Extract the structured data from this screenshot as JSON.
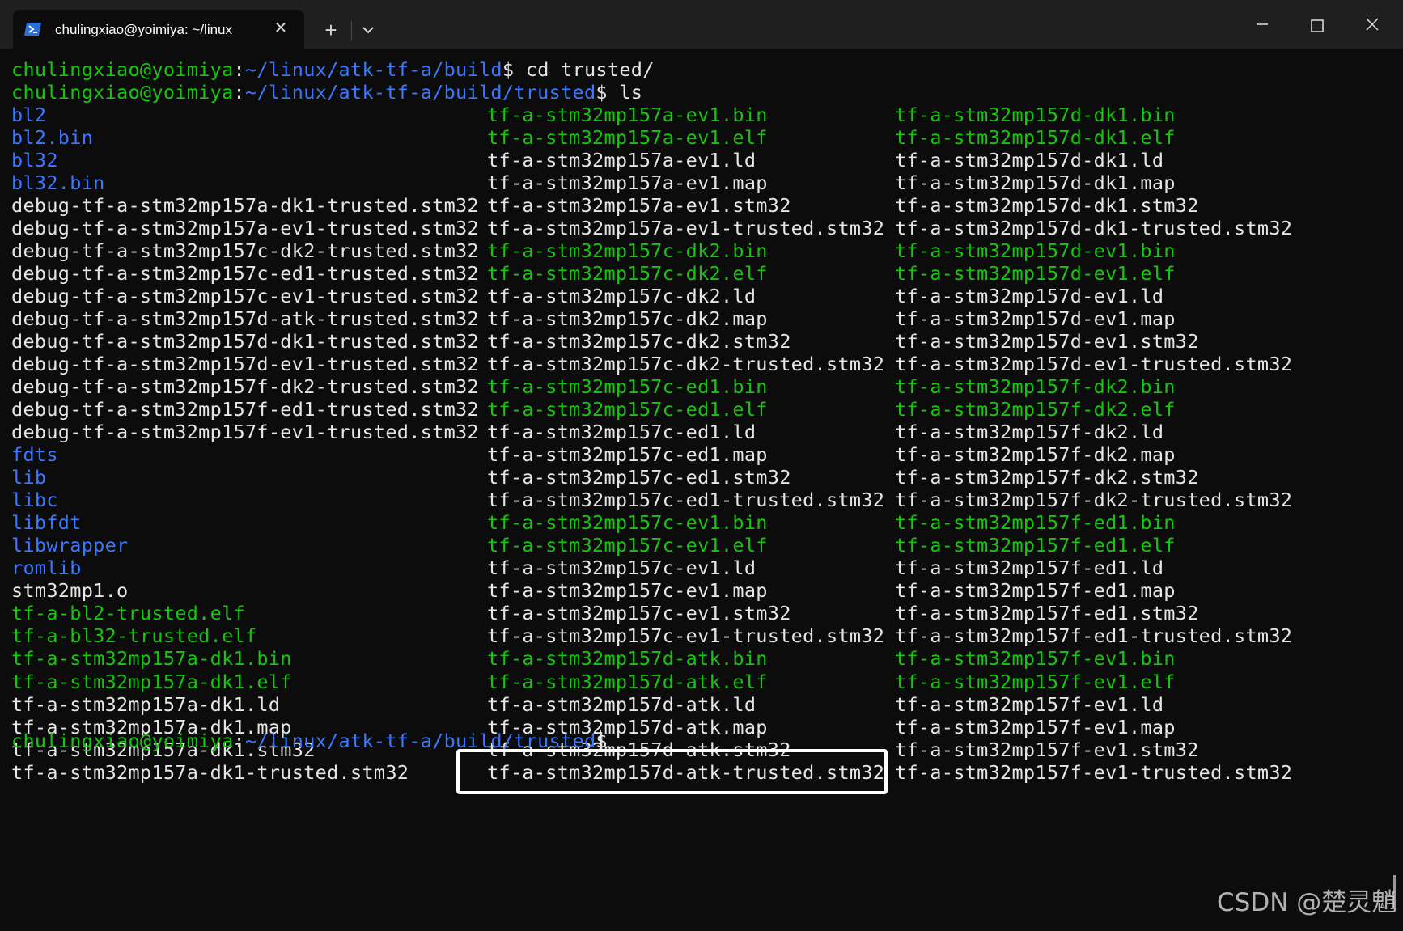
{
  "window": {
    "tab_title": "chulingxiao@yoimiya: ~/linux",
    "new_tab_symbol": "+",
    "close_tab_symbol": "✕"
  },
  "colors": {
    "background": "#0c0c0c",
    "prompt_user": "#16c60c",
    "prompt_path": "#3b78ff",
    "text": "#e6e6e6",
    "executable": "#16c60c",
    "directory": "#3b78ff"
  },
  "prompts": [
    {
      "user": "chulingxiao@yoimiya",
      "path": "~/linux/atk-tf-a/build",
      "command": " cd trusted/"
    },
    {
      "user": "chulingxiao@yoimiya",
      "path": "~/linux/atk-tf-a/build/trusted",
      "command": " ls"
    }
  ],
  "listing": [
    [
      {
        "name": "bl2",
        "kind": "dir"
      },
      {
        "name": "bl2.bin",
        "kind": "dir"
      },
      {
        "name": "bl32",
        "kind": "dir"
      },
      {
        "name": "bl32.bin",
        "kind": "dir"
      },
      {
        "name": "debug-tf-a-stm32mp157a-dk1-trusted.stm32",
        "kind": "file"
      },
      {
        "name": "debug-tf-a-stm32mp157a-ev1-trusted.stm32",
        "kind": "file"
      },
      {
        "name": "debug-tf-a-stm32mp157c-dk2-trusted.stm32",
        "kind": "file"
      },
      {
        "name": "debug-tf-a-stm32mp157c-ed1-trusted.stm32",
        "kind": "file"
      },
      {
        "name": "debug-tf-a-stm32mp157c-ev1-trusted.stm32",
        "kind": "file"
      },
      {
        "name": "debug-tf-a-stm32mp157d-atk-trusted.stm32",
        "kind": "file"
      },
      {
        "name": "debug-tf-a-stm32mp157d-dk1-trusted.stm32",
        "kind": "file"
      },
      {
        "name": "debug-tf-a-stm32mp157d-ev1-trusted.stm32",
        "kind": "file"
      },
      {
        "name": "debug-tf-a-stm32mp157f-dk2-trusted.stm32",
        "kind": "file"
      },
      {
        "name": "debug-tf-a-stm32mp157f-ed1-trusted.stm32",
        "kind": "file"
      },
      {
        "name": "debug-tf-a-stm32mp157f-ev1-trusted.stm32",
        "kind": "file"
      },
      {
        "name": "fdts",
        "kind": "dir"
      },
      {
        "name": "lib",
        "kind": "dir"
      },
      {
        "name": "libc",
        "kind": "dir"
      },
      {
        "name": "libfdt",
        "kind": "dir"
      },
      {
        "name": "libwrapper",
        "kind": "dir"
      },
      {
        "name": "romlib",
        "kind": "dir"
      },
      {
        "name": "stm32mp1.o",
        "kind": "file"
      },
      {
        "name": "tf-a-bl2-trusted.elf",
        "kind": "exec"
      },
      {
        "name": "tf-a-bl32-trusted.elf",
        "kind": "exec"
      },
      {
        "name": "tf-a-stm32mp157a-dk1.bin",
        "kind": "exec"
      },
      {
        "name": "tf-a-stm32mp157a-dk1.elf",
        "kind": "exec"
      },
      {
        "name": "tf-a-stm32mp157a-dk1.ld",
        "kind": "file"
      },
      {
        "name": "tf-a-stm32mp157a-dk1.map",
        "kind": "file"
      },
      {
        "name": "tf-a-stm32mp157a-dk1.stm32",
        "kind": "file"
      },
      {
        "name": "tf-a-stm32mp157a-dk1-trusted.stm32",
        "kind": "file"
      }
    ],
    [
      {
        "name": "tf-a-stm32mp157a-ev1.bin",
        "kind": "exec"
      },
      {
        "name": "tf-a-stm32mp157a-ev1.elf",
        "kind": "exec"
      },
      {
        "name": "tf-a-stm32mp157a-ev1.ld",
        "kind": "file"
      },
      {
        "name": "tf-a-stm32mp157a-ev1.map",
        "kind": "file"
      },
      {
        "name": "tf-a-stm32mp157a-ev1.stm32",
        "kind": "file"
      },
      {
        "name": "tf-a-stm32mp157a-ev1-trusted.stm32",
        "kind": "file"
      },
      {
        "name": "tf-a-stm32mp157c-dk2.bin",
        "kind": "exec"
      },
      {
        "name": "tf-a-stm32mp157c-dk2.elf",
        "kind": "exec"
      },
      {
        "name": "tf-a-stm32mp157c-dk2.ld",
        "kind": "file"
      },
      {
        "name": "tf-a-stm32mp157c-dk2.map",
        "kind": "file"
      },
      {
        "name": "tf-a-stm32mp157c-dk2.stm32",
        "kind": "file"
      },
      {
        "name": "tf-a-stm32mp157c-dk2-trusted.stm32",
        "kind": "file"
      },
      {
        "name": "tf-a-stm32mp157c-ed1.bin",
        "kind": "exec"
      },
      {
        "name": "tf-a-stm32mp157c-ed1.elf",
        "kind": "exec"
      },
      {
        "name": "tf-a-stm32mp157c-ed1.ld",
        "kind": "file"
      },
      {
        "name": "tf-a-stm32mp157c-ed1.map",
        "kind": "file"
      },
      {
        "name": "tf-a-stm32mp157c-ed1.stm32",
        "kind": "file"
      },
      {
        "name": "tf-a-stm32mp157c-ed1-trusted.stm32",
        "kind": "file"
      },
      {
        "name": "tf-a-stm32mp157c-ev1.bin",
        "kind": "exec"
      },
      {
        "name": "tf-a-stm32mp157c-ev1.elf",
        "kind": "exec"
      },
      {
        "name": "tf-a-stm32mp157c-ev1.ld",
        "kind": "file"
      },
      {
        "name": "tf-a-stm32mp157c-ev1.map",
        "kind": "file"
      },
      {
        "name": "tf-a-stm32mp157c-ev1.stm32",
        "kind": "file"
      },
      {
        "name": "tf-a-stm32mp157c-ev1-trusted.stm32",
        "kind": "file"
      },
      {
        "name": "tf-a-stm32mp157d-atk.bin",
        "kind": "exec"
      },
      {
        "name": "tf-a-stm32mp157d-atk.elf",
        "kind": "exec"
      },
      {
        "name": "tf-a-stm32mp157d-atk.ld",
        "kind": "file"
      },
      {
        "name": "tf-a-stm32mp157d-atk.map",
        "kind": "file"
      },
      {
        "name": "tf-a-stm32mp157d-atk.stm32",
        "kind": "file"
      },
      {
        "name": "tf-a-stm32mp157d-atk-trusted.stm32",
        "kind": "file"
      }
    ],
    [
      {
        "name": "tf-a-stm32mp157d-dk1.bin",
        "kind": "exec"
      },
      {
        "name": "tf-a-stm32mp157d-dk1.elf",
        "kind": "exec"
      },
      {
        "name": "tf-a-stm32mp157d-dk1.ld",
        "kind": "file"
      },
      {
        "name": "tf-a-stm32mp157d-dk1.map",
        "kind": "file"
      },
      {
        "name": "tf-a-stm32mp157d-dk1.stm32",
        "kind": "file"
      },
      {
        "name": "tf-a-stm32mp157d-dk1-trusted.stm32",
        "kind": "file"
      },
      {
        "name": "tf-a-stm32mp157d-ev1.bin",
        "kind": "exec"
      },
      {
        "name": "tf-a-stm32mp157d-ev1.elf",
        "kind": "exec"
      },
      {
        "name": "tf-a-stm32mp157d-ev1.ld",
        "kind": "file"
      },
      {
        "name": "tf-a-stm32mp157d-ev1.map",
        "kind": "file"
      },
      {
        "name": "tf-a-stm32mp157d-ev1.stm32",
        "kind": "file"
      },
      {
        "name": "tf-a-stm32mp157d-ev1-trusted.stm32",
        "kind": "file"
      },
      {
        "name": "tf-a-stm32mp157f-dk2.bin",
        "kind": "exec"
      },
      {
        "name": "tf-a-stm32mp157f-dk2.elf",
        "kind": "exec"
      },
      {
        "name": "tf-a-stm32mp157f-dk2.ld",
        "kind": "file"
      },
      {
        "name": "tf-a-stm32mp157f-dk2.map",
        "kind": "file"
      },
      {
        "name": "tf-a-stm32mp157f-dk2.stm32",
        "kind": "file"
      },
      {
        "name": "tf-a-stm32mp157f-dk2-trusted.stm32",
        "kind": "file"
      },
      {
        "name": "tf-a-stm32mp157f-ed1.bin",
        "kind": "exec"
      },
      {
        "name": "tf-a-stm32mp157f-ed1.elf",
        "kind": "exec"
      },
      {
        "name": "tf-a-stm32mp157f-ed1.ld",
        "kind": "file"
      },
      {
        "name": "tf-a-stm32mp157f-ed1.map",
        "kind": "file"
      },
      {
        "name": "tf-a-stm32mp157f-ed1.stm32",
        "kind": "file"
      },
      {
        "name": "tf-a-stm32mp157f-ed1-trusted.stm32",
        "kind": "file"
      },
      {
        "name": "tf-a-stm32mp157f-ev1.bin",
        "kind": "exec"
      },
      {
        "name": "tf-a-stm32mp157f-ev1.elf",
        "kind": "exec"
      },
      {
        "name": "tf-a-stm32mp157f-ev1.ld",
        "kind": "file"
      },
      {
        "name": "tf-a-stm32mp157f-ev1.map",
        "kind": "file"
      },
      {
        "name": "tf-a-stm32mp157f-ev1.stm32",
        "kind": "file"
      },
      {
        "name": "tf-a-stm32mp157f-ev1-trusted.stm32",
        "kind": "file"
      }
    ]
  ],
  "final_prompt": {
    "user": "chulingxiao@yoimiya",
    "path": "~/linux/atk-tf-a/build/trusted",
    "suffix": "$ "
  },
  "watermark": "CSDN @楚灵魈"
}
